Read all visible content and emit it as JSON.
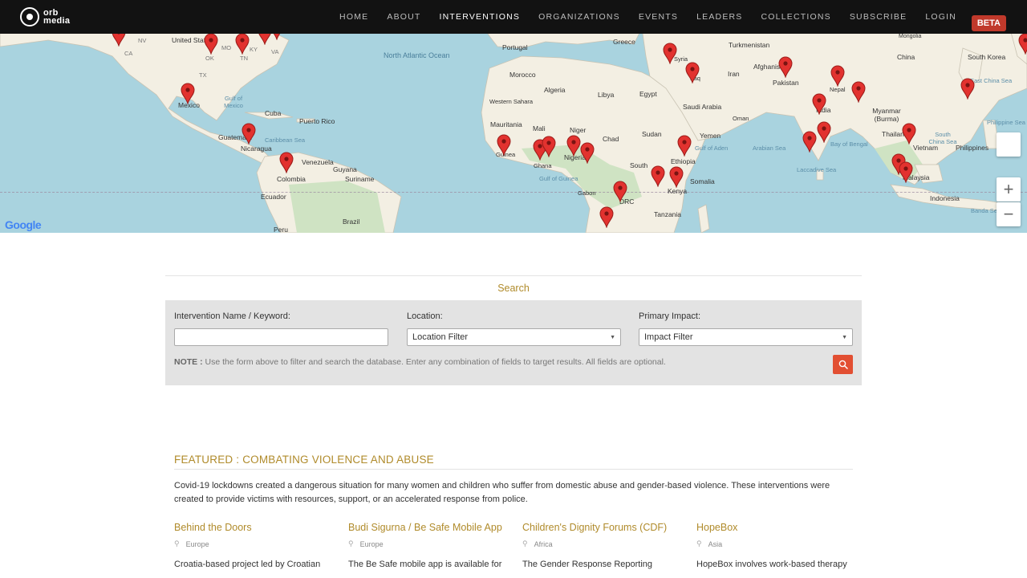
{
  "nav": {
    "logo_line1": "orb",
    "logo_line2": "media",
    "links": [
      "HOME",
      "ABOUT",
      "INTERVENTIONS",
      "ORGANIZATIONS",
      "EVENTS",
      "LEADERS",
      "COLLECTIONS",
      "SUBSCRIBE",
      "LOGIN"
    ],
    "active": "INTERVENTIONS",
    "beta": "BETA"
  },
  "map": {
    "provider_logo": "Google",
    "zoom_in": "+",
    "zoom_out": "−",
    "oceans": [
      "North Atlantic Ocean"
    ],
    "country_labels": [
      "United States",
      "Mexico",
      "Cuba",
      "Puerto Rico",
      "Guatemala",
      "Nicaragua",
      "Venezuela",
      "Colombia",
      "Guyana",
      "Suriname",
      "Ecuador",
      "Peru",
      "Brazil",
      "Portugal",
      "Greece",
      "Morocco",
      "Algeria",
      "Libya",
      "Egypt",
      "Western Sahara",
      "Mauritania",
      "Mali",
      "Niger",
      "Chad",
      "Sudan",
      "Nigeria",
      "Ghana",
      "Guinea",
      "South",
      "Ethiopia",
      "Somalia",
      "Kenya",
      "DRC",
      "Tanzania",
      "Gabon",
      "Syria",
      "Iraq",
      "Iran",
      "Saudi Arabia",
      "Yemen",
      "Oman",
      "Turkmenistan",
      "Afghanistan",
      "Pakistan",
      "Nepal",
      "India",
      "China",
      "Myanmar (Burma)",
      "Thailand",
      "Vietnam",
      "Malaysia",
      "Philippines",
      "Indonesia",
      "South Korea",
      "Mongolia"
    ],
    "sea_labels": [
      "Gulf of Mexico",
      "Caribbean Sea",
      "Gulf of Guinea",
      "Gulf of Aden",
      "Arabian Sea",
      "Bay of Bengal",
      "Laccadive Sea",
      "South China Sea",
      "East China Sea",
      "Philippine Sea",
      "Banda Sea"
    ],
    "state_labels": [
      "CA",
      "NV",
      "OK",
      "TX",
      "MO",
      "TN",
      "KY",
      "VA"
    ]
  },
  "search": {
    "title": "Search",
    "keyword_label": "Intervention Name / Keyword:",
    "keyword_value": "",
    "location_label": "Location:",
    "location_value": "Location Filter",
    "impact_label": "Primary Impact:",
    "impact_value": "Impact Filter",
    "note_prefix": "NOTE :",
    "note_text": " Use the form above to filter and search the database. Enter any combination of fields to target results. All fields are optional."
  },
  "featured": {
    "title": "FEATURED : COMBATING VIOLENCE AND ABUSE",
    "description": "Covid-19 lockdowns created a dangerous situation for many women and children who suffer from domestic abuse and gender-based violence. These interventions were created to provide victims with resources, support, or an accelerated response from police.",
    "cards": [
      {
        "title": "Behind the Doors",
        "region": "Europe",
        "text": "Croatia-based project led by Croatian"
      },
      {
        "title": "Budi Sigurna / Be Safe Mobile App",
        "region": "Europe",
        "text": "The Be Safe mobile app is available for"
      },
      {
        "title": "Children's Dignity Forums (CDF)",
        "region": "Africa",
        "text": "The Gender Response Reporting"
      },
      {
        "title": "HopeBox",
        "region": "Asia",
        "text": "HopeBox involves work-based therapy"
      }
    ]
  },
  "colors": {
    "accent": "#b08b2b",
    "nav_bg": "#121212",
    "pin": "#e2322f",
    "search_button": "#e24f32",
    "beta_badge": "#c0392b"
  }
}
